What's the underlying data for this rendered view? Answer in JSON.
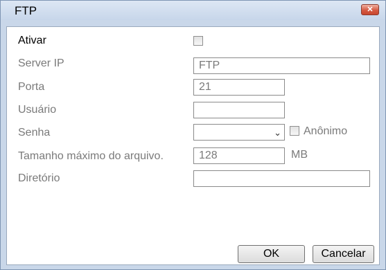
{
  "window": {
    "title": "FTP",
    "close_label": "✕"
  },
  "form": {
    "enable_label": "Ativar",
    "server_ip_label": "Server IP",
    "server_ip_value": "FTP",
    "port_label": "Porta",
    "port_value": "21",
    "user_label": "Usuário",
    "user_value": "",
    "password_label": "Senha",
    "password_value": "",
    "anonymous_label": "Anônimo",
    "max_file_size_label": "Tamanho máximo do arquivo.",
    "max_file_size_value": "128",
    "max_file_size_unit": "MB",
    "directory_label": "Diretório",
    "directory_value": ""
  },
  "buttons": {
    "ok_label": "OK",
    "cancel_label": "Cancelar"
  }
}
